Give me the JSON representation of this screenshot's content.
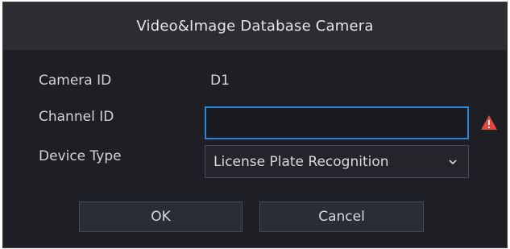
{
  "dialog": {
    "title": "Video&Image Database Camera",
    "fields": {
      "camera_id_label": "Camera ID",
      "camera_id_value": "D1",
      "channel_id_label": "Channel ID",
      "channel_id_value": "",
      "device_type_label": "Device Type",
      "device_type_value": "License Plate Recognition"
    },
    "warning_icon": "warning-triangle-icon",
    "warning_color": "#e5473b",
    "accent_color": "#2b84d8",
    "buttons": {
      "ok_label": "OK",
      "cancel_label": "Cancel"
    }
  }
}
